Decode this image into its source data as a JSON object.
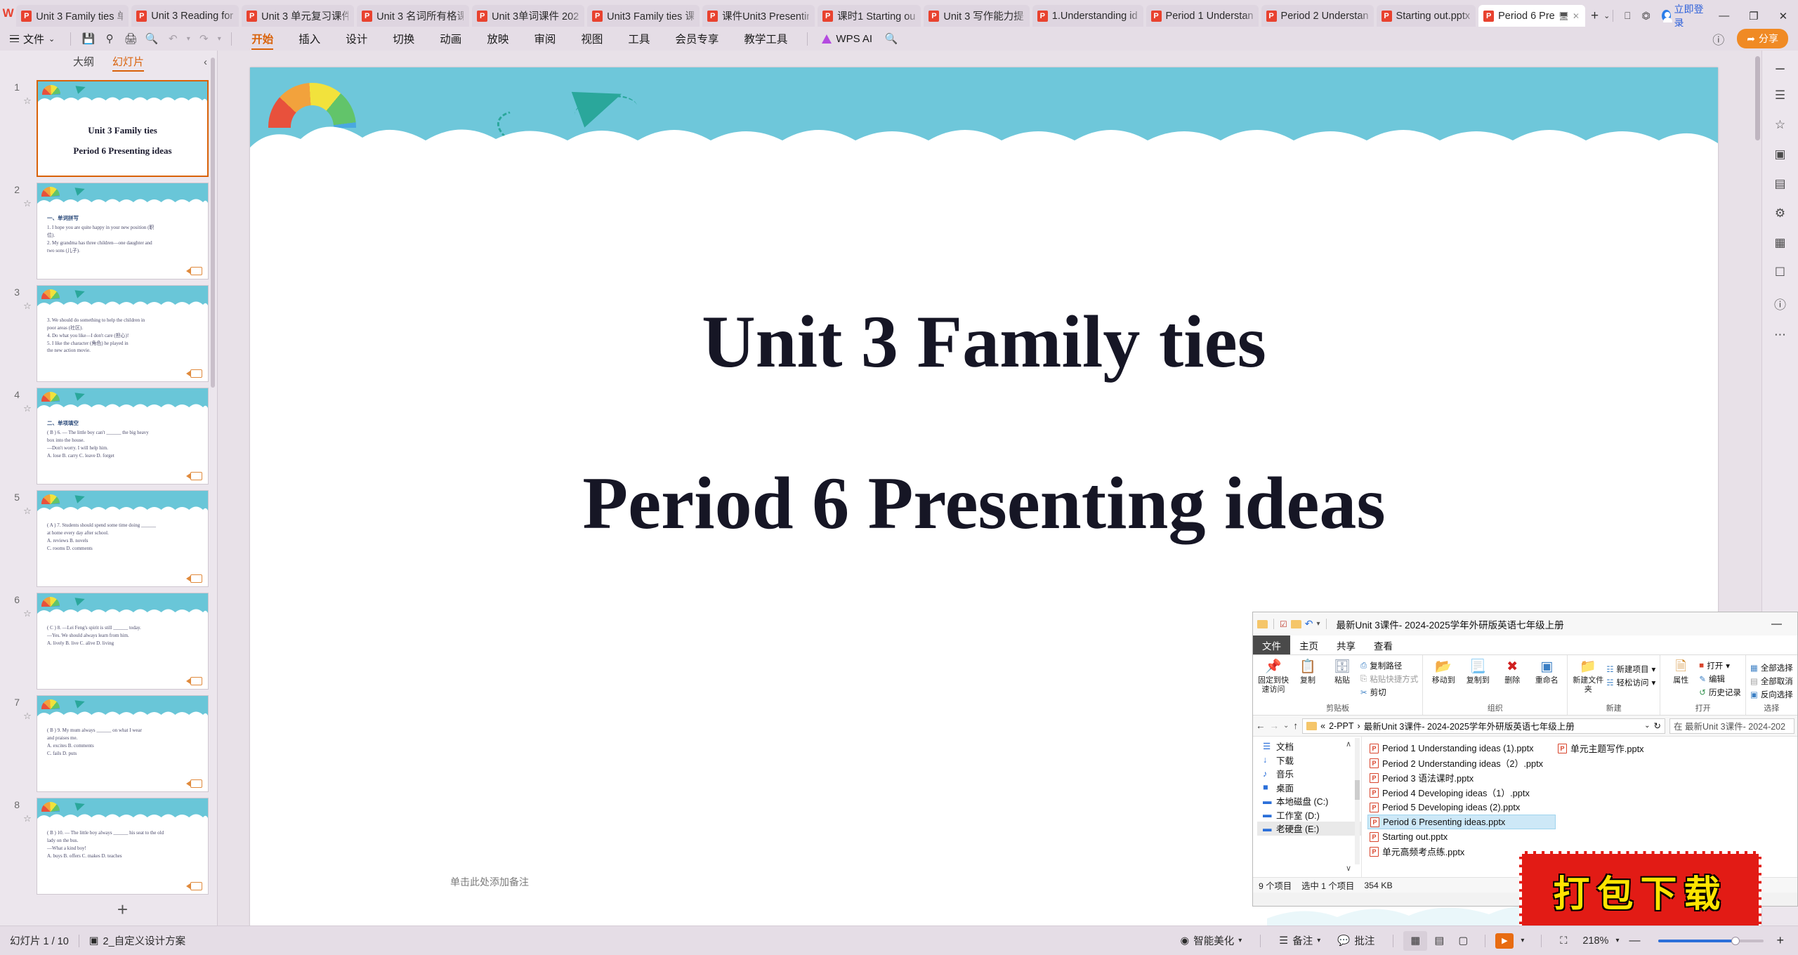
{
  "app": {
    "logo": "wps-logo",
    "tabs": [
      {
        "label": "Unit 3 Family ties 单",
        "active": false
      },
      {
        "label": "Unit 3 Reading for",
        "active": false
      },
      {
        "label": "Unit 3 单元复习课件",
        "active": false
      },
      {
        "label": "Unit 3 名词所有格课",
        "active": false
      },
      {
        "label": "Unit 3单词课件 202",
        "active": false
      },
      {
        "label": "Unit3 Family ties 课",
        "active": false
      },
      {
        "label": "课件Unit3 Presentin",
        "active": false
      },
      {
        "label": "课时1  Starting ou",
        "active": false
      },
      {
        "label": "Unit 3  写作能力提",
        "active": false
      },
      {
        "label": "1.Understanding id",
        "active": false
      },
      {
        "label": "Period 1 Understan",
        "active": false
      },
      {
        "label": "Period 2 Understan",
        "active": false
      },
      {
        "label": "Starting out.pptx",
        "active": false
      },
      {
        "label": "Period 6 Pre",
        "active": true
      }
    ],
    "new_tab": "+",
    "new_tab_caret": "⌄",
    "right_icons": [
      "copy-window-icon",
      "cube-icon"
    ],
    "login_label": "立即登录",
    "minimize": "—",
    "maximize": "❐",
    "close": "✕"
  },
  "ribbon": {
    "file_menu": "文件",
    "file_caret": "⌄",
    "quick_icons": [
      "save-icon",
      "save-as-icon",
      "print-icon",
      "print-preview-icon",
      "undo-icon",
      "redo-icon",
      "more-caret-icon"
    ],
    "tabs": [
      {
        "label": "开始",
        "active": true
      },
      {
        "label": "插入",
        "active": false
      },
      {
        "label": "设计",
        "active": false
      },
      {
        "label": "切换",
        "active": false
      },
      {
        "label": "动画",
        "active": false
      },
      {
        "label": "放映",
        "active": false
      },
      {
        "label": "审阅",
        "active": false
      },
      {
        "label": "视图",
        "active": false
      },
      {
        "label": "工具",
        "active": false
      },
      {
        "label": "会员专享",
        "active": false
      },
      {
        "label": "教学工具",
        "active": false
      }
    ],
    "wps_ai": "WPS AI",
    "search_icon": "search-icon",
    "help_icon": "help-icon",
    "share_label": "分享"
  },
  "panel": {
    "tab_outline": "大纲",
    "tab_slides": "幻灯片",
    "collapse_icon": "chevron-left-icon",
    "add_slide": "+",
    "slides": [
      {
        "num": "1",
        "selected": true,
        "type": "title",
        "title1": "Unit 3 Family ties",
        "title2": "Period 6 Presenting ideas"
      },
      {
        "num": "2",
        "selected": false,
        "type": "text",
        "heading": "一、单词拼写",
        "lines": [
          "1. I hope you are quite happy in your new position  (职",
          "位).",
          "2. My grandma has three children—one daughter and",
          "two sons          (儿子)."
        ]
      },
      {
        "num": "3",
        "selected": false,
        "type": "text",
        "heading": "",
        "lines": [
          "3. We should do something to help the children in",
          "poor areas  (社区).",
          "4. Do what you like—I don't care   (担心)!",
          "5. I like the character    (角色) he played in",
          "the new action movie."
        ]
      },
      {
        "num": "4",
        "selected": false,
        "type": "text",
        "heading": "二、单项填空",
        "lines": [
          "(  B  ) 6. — The little boy can't ______ the big heavy",
          "box into the house.",
          "—Don't worry. I will help him.",
          "A. lose     B. carry     C. leave     D. forget"
        ]
      },
      {
        "num": "5",
        "selected": false,
        "type": "text",
        "heading": "",
        "lines": [
          "(  A  ) 7. Students should spend some time doing ______",
          "at home every day after school.",
          "A. reviews              B. novels",
          "C. rooms                D. comments"
        ]
      },
      {
        "num": "6",
        "selected": false,
        "type": "text",
        "heading": "",
        "lines": [
          "(  C  ) 8. —Lei Feng's spirit is still ______ today.",
          "—Yes. We should always learn from him.",
          "A. lively     B. live     C. alive     D. living"
        ]
      },
      {
        "num": "7",
        "selected": false,
        "type": "text",
        "heading": "",
        "lines": [
          "(  B  ) 9. My mum always ______ on what I wear",
          "and praises me.",
          "A. excites              B. comments",
          "C. fails                D. puts"
        ]
      },
      {
        "num": "8",
        "selected": false,
        "type": "text",
        "heading": "",
        "lines": [
          "(  B  ) 10. — The little boy always ______ his seat to the old",
          "lady on the bus.",
          "—What a kind boy!",
          "A. buys     B. offers     C. makes     D. teaches"
        ]
      }
    ]
  },
  "slide": {
    "title_line1": "Unit 3 Family ties",
    "title_line2": "Period 6 Presenting ideas",
    "note_placeholder": "单击此处添加备注"
  },
  "right_toolbar": {
    "icons": [
      "minus-icon",
      "list-icon",
      "star-icon",
      "image-icon",
      "chart-icon",
      "shapes-icon",
      "table-icon",
      "help-circle-icon",
      "more-dots-icon"
    ]
  },
  "status": {
    "slide_counter": "幻灯片 1 / 10",
    "design_scheme": "2_自定义设计方案",
    "beautify": "智能美化",
    "notes": "备注",
    "comments": "批注",
    "zoom_value": "218%",
    "zoom_minus": "—",
    "zoom_plus": "+",
    "fit_icon": "fit-to-window-icon",
    "view_normal": "normal-view-icon",
    "view_sorter": "slide-sorter-icon",
    "view_reading": "reading-view-icon",
    "play_icon": "play-icon"
  },
  "explorer": {
    "title": "最新Unit 3课件- 2024-2025学年外研版英语七年级上册",
    "minimize": "—",
    "tabs": [
      "文件",
      "主页",
      "共享",
      "查看"
    ],
    "ribbon_groups": [
      {
        "label": "剪贴板",
        "buttons": [
          {
            "icon": "pin-icon",
            "label": "固定到快速访问"
          },
          {
            "icon": "copy-icon",
            "label": "复制"
          },
          {
            "icon": "paste-icon",
            "label": "粘贴"
          }
        ],
        "small": [
          "复制路径",
          "粘贴快捷方式",
          "剪切"
        ]
      },
      {
        "label": "组织",
        "buttons": [
          {
            "icon": "move-to-icon",
            "label": "移动到"
          },
          {
            "icon": "copy-to-icon",
            "label": "复制到"
          },
          {
            "icon": "delete-icon",
            "label": "删除"
          },
          {
            "icon": "rename-icon",
            "label": "重命名"
          }
        ],
        "small": []
      },
      {
        "label": "新建",
        "buttons": [
          {
            "icon": "new-folder-icon",
            "label": "新建文件夹"
          }
        ],
        "small": [
          "新建项目",
          "轻松访问"
        ]
      },
      {
        "label": "打开",
        "buttons": [
          {
            "icon": "properties-icon",
            "label": "属性"
          }
        ],
        "small": [
          "打开",
          "编辑",
          "历史记录"
        ]
      },
      {
        "label": "选择",
        "buttons": [],
        "small": [
          "全部选择",
          "全部取消",
          "反向选择"
        ]
      }
    ],
    "address": {
      "back": "←",
      "forward": "→",
      "history": "⌄",
      "up": "↑",
      "crumb1": "2-PPT",
      "crumb2": "最新Unit 3课件- 2024-2025学年外研版英语七年级上册",
      "dropdown": "⌄",
      "refresh": "↻"
    },
    "search_placeholder": "在 最新Unit 3课件- 2024-202",
    "nav_items": [
      {
        "icon": "documents-icon",
        "label": "文档",
        "selected": false
      },
      {
        "icon": "download-icon",
        "label": "下载",
        "selected": false
      },
      {
        "icon": "music-icon",
        "label": "音乐",
        "selected": false
      },
      {
        "icon": "desktop-icon",
        "label": "桌面",
        "selected": false
      },
      {
        "icon": "drive-icon",
        "label": "本地磁盘 (C:)",
        "selected": false
      },
      {
        "icon": "drive-icon",
        "label": "工作室 (D:)",
        "selected": false
      },
      {
        "icon": "drive-icon",
        "label": "老硬盘 (E:)",
        "selected": true
      }
    ],
    "files": [
      {
        "name": "Period 1 Understanding ideas (1).pptx",
        "selected": false
      },
      {
        "name": "Period 2 Understanding ideas（2）.pptx",
        "selected": false
      },
      {
        "name": "Period 3 语法课时.pptx",
        "selected": false
      },
      {
        "name": "Period 4 Developing ideas（1）.pptx",
        "selected": false
      },
      {
        "name": "Period 5 Developing ideas (2).pptx",
        "selected": false
      },
      {
        "name": "Period 6 Presenting ideas.pptx",
        "selected": true
      },
      {
        "name": "Starting out.pptx",
        "selected": false
      },
      {
        "name": "单元高频考点练.pptx",
        "selected": false
      },
      {
        "name": "单元主题写作.pptx",
        "selected": false
      }
    ],
    "status_items": [
      "9 个项目",
      "选中 1 个项目",
      "354 KB"
    ]
  },
  "watermark": {
    "text": "打包下载",
    "bg_color": "#e21b15",
    "text_color": "#ffe400"
  }
}
